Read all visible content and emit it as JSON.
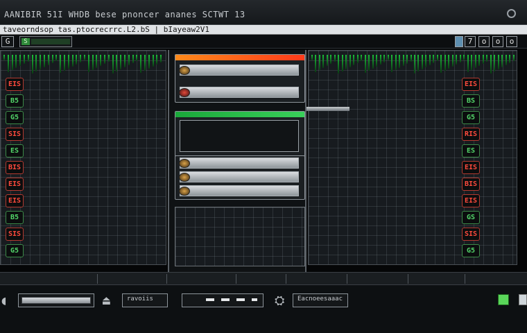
{
  "window": {
    "title": "AANIBIR 51I WHDB bese pnoncer ananes SCTWT 13"
  },
  "menubar": {
    "path": "taveorndsop tas.ptocrecrrc.L2.bS | bIayeaw2V1"
  },
  "toolbar": {
    "left_button": "G",
    "field_indicator": "S",
    "right_buttons": [
      "7",
      "o",
      "o",
      "o"
    ]
  },
  "channels": {
    "left": [
      {
        "label": "EIS",
        "color": "red"
      },
      {
        "label": "B5",
        "color": "green"
      },
      {
        "label": "G5",
        "color": "green"
      },
      {
        "label": "SIS",
        "color": "red"
      },
      {
        "label": "ES",
        "color": "green"
      },
      {
        "label": "BIS",
        "color": "red"
      },
      {
        "label": "EIS",
        "color": "red"
      },
      {
        "label": "EIS",
        "color": "red"
      },
      {
        "label": "B5",
        "color": "green"
      },
      {
        "label": "SIS",
        "color": "red"
      },
      {
        "label": "G5",
        "color": "green"
      }
    ],
    "right": [
      {
        "label": "EIS",
        "color": "red"
      },
      {
        "label": "BS",
        "color": "green"
      },
      {
        "label": "G5",
        "color": "green"
      },
      {
        "label": "RIS",
        "color": "red"
      },
      {
        "label": "ES",
        "color": "green"
      },
      {
        "label": "EIS",
        "color": "red"
      },
      {
        "label": "BIS",
        "color": "red"
      },
      {
        "label": "EIS",
        "color": "red"
      },
      {
        "label": "GS",
        "color": "green"
      },
      {
        "label": "SIS",
        "color": "red"
      },
      {
        "label": "G5",
        "color": "green"
      }
    ]
  },
  "bottom": {
    "field_1": "ravoiis",
    "field_2": "Eacnoeesaaac"
  },
  "colors": {
    "accent_green": "#53d66a",
    "accent_red": "#ff4a3c",
    "panel_bg": "#171b1f"
  }
}
